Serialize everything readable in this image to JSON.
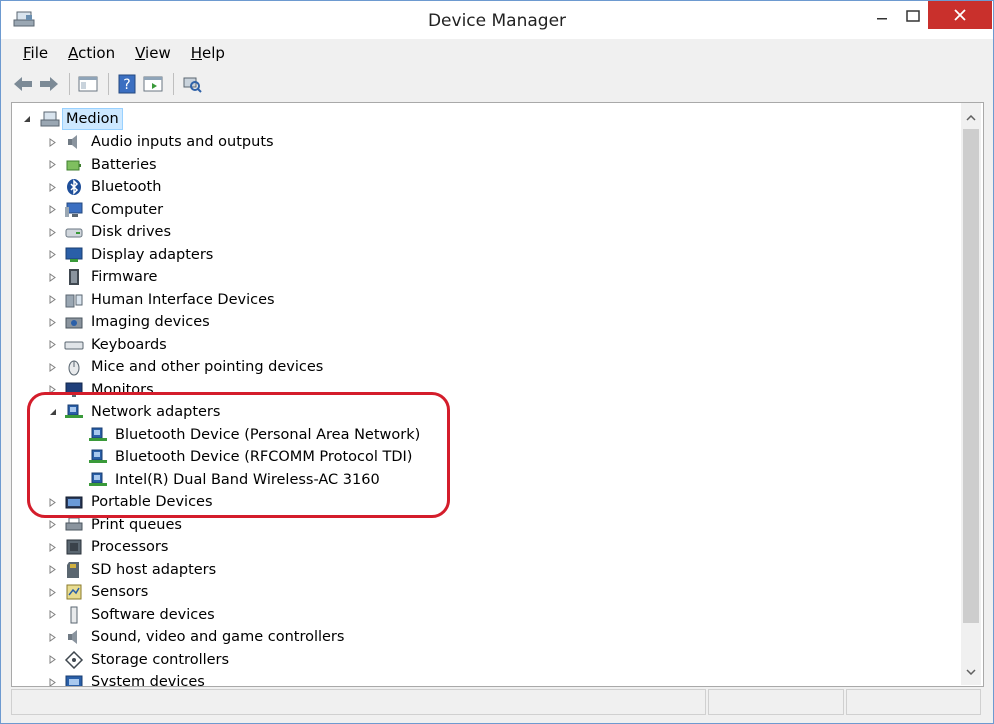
{
  "window": {
    "title": "Device Manager"
  },
  "menu": [
    {
      "label": "File"
    },
    {
      "label": "Action"
    },
    {
      "label": "View"
    },
    {
      "label": "Help"
    }
  ],
  "tree": {
    "root": {
      "label": "Medion",
      "expanded": true
    },
    "categories": [
      {
        "label": "Audio inputs and outputs",
        "icon": "speaker-icon"
      },
      {
        "label": "Batteries",
        "icon": "battery-icon"
      },
      {
        "label": "Bluetooth",
        "icon": "bluetooth-icon"
      },
      {
        "label": "Computer",
        "icon": "computer-icon"
      },
      {
        "label": "Disk drives",
        "icon": "disk-drive-icon"
      },
      {
        "label": "Display adapters",
        "icon": "display-adapter-icon"
      },
      {
        "label": "Firmware",
        "icon": "firmware-icon"
      },
      {
        "label": "Human Interface Devices",
        "icon": "hid-icon"
      },
      {
        "label": "Imaging devices",
        "icon": "camera-icon"
      },
      {
        "label": "Keyboards",
        "icon": "keyboard-icon"
      },
      {
        "label": "Mice and other pointing devices",
        "icon": "mouse-icon"
      },
      {
        "label": "Monitors",
        "icon": "monitor-icon"
      },
      {
        "label": "Network adapters",
        "icon": "network-adapter-icon",
        "expanded": true,
        "children": [
          {
            "label": "Bluetooth Device (Personal Area Network)"
          },
          {
            "label": "Bluetooth Device (RFCOMM Protocol TDI)"
          },
          {
            "label": "Intel(R) Dual Band Wireless-AC 3160"
          }
        ]
      },
      {
        "label": "Portable Devices",
        "icon": "portable-device-icon"
      },
      {
        "label": "Print queues",
        "icon": "printer-icon"
      },
      {
        "label": "Processors",
        "icon": "processor-icon"
      },
      {
        "label": "SD host adapters",
        "icon": "sd-card-icon"
      },
      {
        "label": "Sensors",
        "icon": "sensor-icon"
      },
      {
        "label": "Software devices",
        "icon": "software-device-icon"
      },
      {
        "label": "Sound, video and game controllers",
        "icon": "sound-icon"
      },
      {
        "label": "Storage controllers",
        "icon": "storage-controller-icon"
      },
      {
        "label": "System devices",
        "icon": "system-device-icon"
      }
    ]
  },
  "colors": {
    "highlight": "#d41d2b",
    "close_button": "#c9302c",
    "root_selection": "#cde8ff"
  }
}
